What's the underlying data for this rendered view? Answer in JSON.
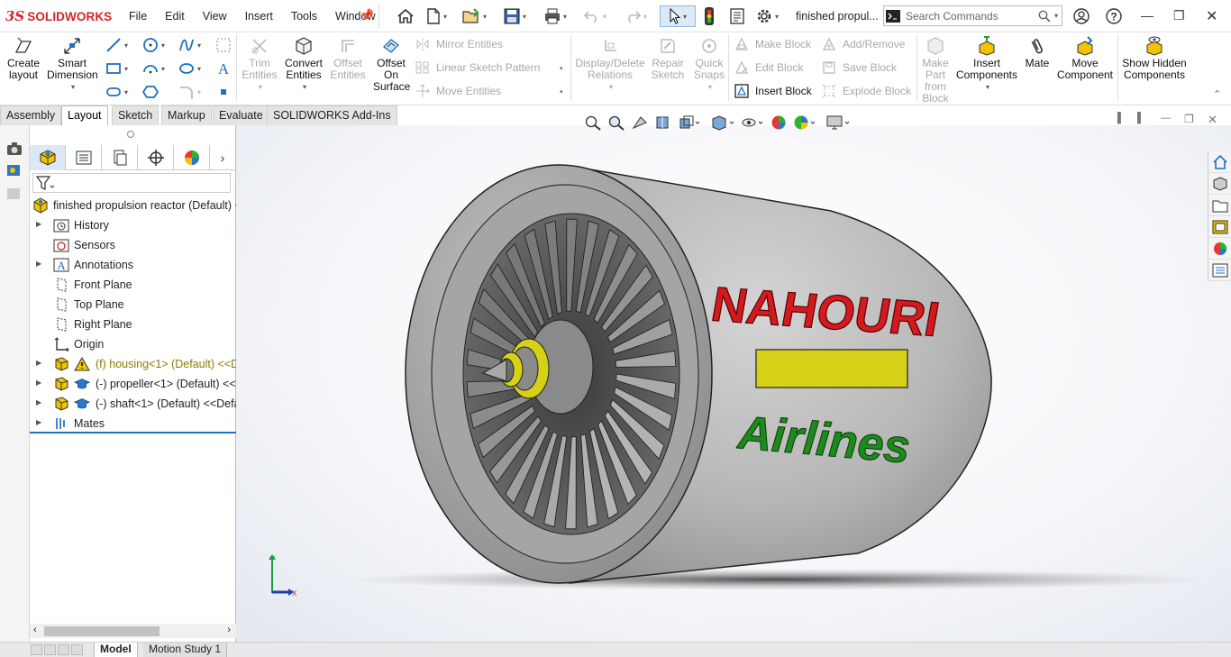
{
  "app": {
    "logo_ds": "3S",
    "logo_text": "SOLIDWORKS"
  },
  "menu": [
    "File",
    "Edit",
    "View",
    "Insert",
    "Tools",
    "Window"
  ],
  "doc_title": "finished propul...",
  "search": {
    "placeholder": "Search Commands"
  },
  "ribbon": {
    "create_layout": "Create layout",
    "smart_dimension": "Smart Dimension",
    "trim_entities": "Trim Entities",
    "convert_entities": "Convert Entities",
    "offset_entities": "Offset Entities",
    "offset_on_surface": "Offset On Surface",
    "mirror_entities": "Mirror Entities",
    "linear_sketch_pattern": "Linear Sketch Pattern",
    "move_entities": "Move Entities",
    "display_delete_relations": "Display/Delete Relations",
    "repair_sketch": "Repair Sketch",
    "quick_snaps": "Quick Snaps",
    "make_block": "Make Block",
    "edit_block": "Edit Block",
    "insert_block": "Insert Block",
    "add_remove": "Add/Remove",
    "save_block": "Save Block",
    "explode_block": "Explode Block",
    "make_part_from_block": "Make Part from Block",
    "insert_components": "Insert Components",
    "mate": "Mate",
    "move_component": "Move Component",
    "show_hidden_components": "Show Hidden Components"
  },
  "tabs": [
    "Assembly",
    "Layout",
    "Sketch",
    "Markup",
    "Evaluate",
    "SOLIDWORKS Add-Ins"
  ],
  "active_tab": "Layout",
  "tree": {
    "root": "finished propulsion reactor  (Default) <",
    "items": [
      {
        "label": "History"
      },
      {
        "label": "Sensors"
      },
      {
        "label": "Annotations"
      },
      {
        "label": "Front Plane"
      },
      {
        "label": "Top Plane"
      },
      {
        "label": "Right Plane"
      },
      {
        "label": "Origin"
      },
      {
        "label": "(f) housing<1> (Default) <<D"
      },
      {
        "label": "(-) propeller<1> (Default) <<"
      },
      {
        "label": "(-) shaft<1> (Default) <<Defa"
      },
      {
        "label": "Mates"
      }
    ]
  },
  "model": {
    "brand_top": "NAHOURI",
    "brand_bottom": "Airlines"
  },
  "triad": {
    "y": "Y",
    "x": "X"
  },
  "bottom_tabs": [
    "Model",
    "Motion Study 1"
  ],
  "colors": {
    "brand_red": "#d41a1f",
    "brand_green": "#1c8a1c",
    "stripe_yellow": "#d6d016",
    "accent_blue": "#1f6fc5",
    "warning_yellow": "#f2c400"
  }
}
